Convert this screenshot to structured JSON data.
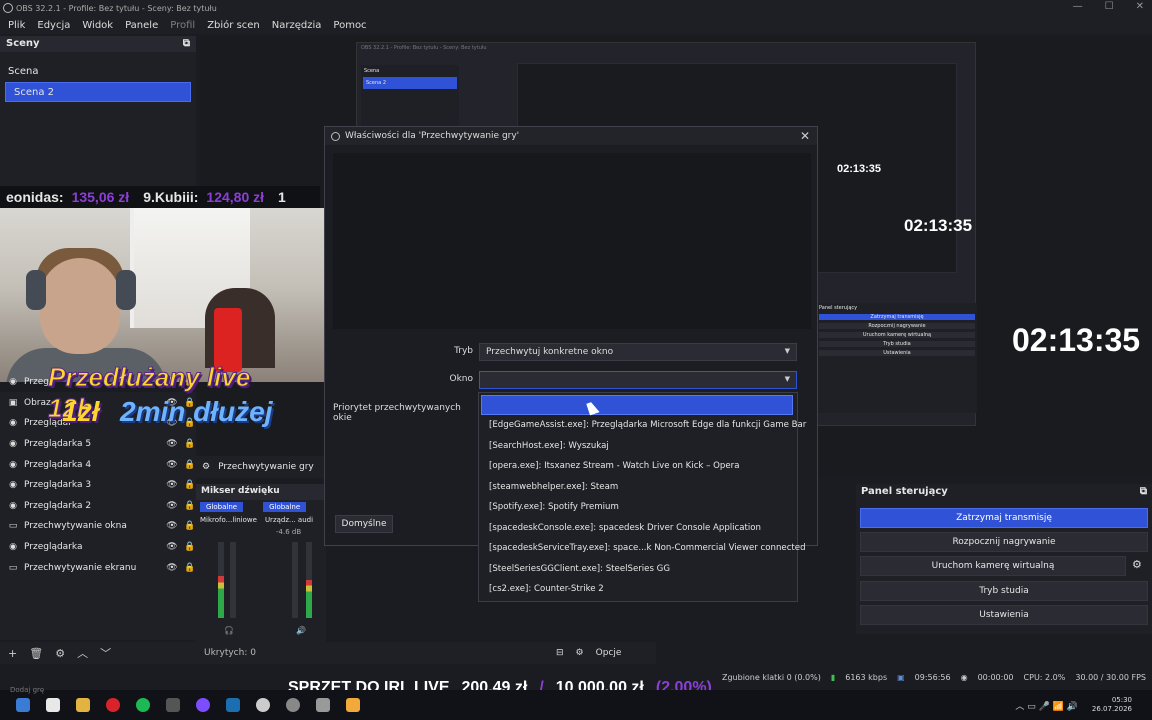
{
  "window": {
    "title": "OBS 32.2.1 - Profile: Bez tytułu - Sceny: Bez tytułu",
    "min": "—",
    "max": "☐",
    "close": "✕"
  },
  "menu": [
    "Plik",
    "Edycja",
    "Widok",
    "Panele",
    "Profil",
    "Zbiór scen",
    "Narzędzia",
    "Pomoc"
  ],
  "scenes": {
    "title": "Sceny",
    "items": [
      "Scena",
      "Scena 2"
    ],
    "selected": 1
  },
  "overlay": {
    "donor1_name": "eonidas:",
    "donor1_amount": "135,06 zł",
    "donor2_name": "9.Kubiii:",
    "donor2_amount": "124,80 zł",
    "donor3": "1",
    "promo_line1": "Przedłużany live 12h",
    "promo_line2": "1zł",
    "promo_line3": "2min dłużej",
    "clock_small": "02:13:35",
    "clock_mid": "02:13:35",
    "clock_big": "02:13:35"
  },
  "sources": {
    "items": [
      {
        "name": "Przeg",
        "icon": "◉"
      },
      {
        "name": "Obraz",
        "icon": "▣"
      },
      {
        "name": "Przeglądar",
        "icon": "◉"
      },
      {
        "name": "Przeglądarka 5",
        "icon": "◉"
      },
      {
        "name": "Przeglądarka 4",
        "icon": "◉"
      },
      {
        "name": "Przeglądarka 3",
        "icon": "◉"
      },
      {
        "name": "Przeglądarka 2",
        "icon": "◉"
      },
      {
        "name": "Przechwytywanie okna",
        "icon": "▭"
      },
      {
        "name": "Przeglądarka",
        "icon": "◉"
      },
      {
        "name": "Przechwytywanie ekranu",
        "icon": "▭"
      }
    ],
    "add": "+",
    "remove": "🗑",
    "settings": "⚙",
    "up": "︿",
    "down": "﹀"
  },
  "toolbar_mid": {
    "source_label": "Przechwytywanie gry",
    "hidden": "Ukrytych: 0",
    "options": "Opcje"
  },
  "mixer": {
    "title": "Mikser dźwięku",
    "tab_global": "Globalne",
    "tab_global2": "Globalne",
    "ch1": "Mikrofo...liniowe",
    "ch2": "Urządz... audi",
    "db": "-4.6 dB",
    "mic_level": 0.55,
    "desk_level": 0.5
  },
  "dialog": {
    "title": "Właściwości dla 'Przechwytywanie gry'",
    "close": "✕",
    "mode_label": "Tryb",
    "mode_value": "Przechwytuj konkretne okno",
    "window_label": "Okno",
    "window_value": "",
    "priority_label": "Priorytet przechwytywanych okie",
    "defaults": "Domyślne"
  },
  "dropdown": {
    "options": [
      "[EdgeGameAssist.exe]: Przeglądarka Microsoft Edge dla funkcji Game Bar",
      "[SearchHost.exe]: Wyszukaj",
      "[opera.exe]: Itsxanez Stream - Watch Live on Kick – Opera",
      "[steamwebhelper.exe]: Steam",
      "[Spotify.exe]: Spotify Premium",
      "[spacedeskConsole.exe]: spacedesk Driver Console Application",
      "[spacedeskServiceTray.exe]: space...k Non-Commercial Viewer connected",
      "[SteelSeriesGGClient.exe]: SteelSeries GG",
      "[cs2.exe]: Counter-Strike 2"
    ]
  },
  "controls": {
    "title": "Panel sterujący",
    "buttons": [
      "Zatrzymaj transmisję",
      "Rozpocznij nagrywanie",
      "Uruchom kamerę wirtualną",
      "Tryb studia",
      "Ustawienia"
    ],
    "active": 0
  },
  "status": {
    "dropped": "Zgubione klatki 0 (0.0%)",
    "kbps": "6163 kbps",
    "stream_time": "09:56:56",
    "rec_time": "00:00:00",
    "cpu": "CPU: 2.0%",
    "fps": "30.00 / 30.00 FPS"
  },
  "ticker": {
    "label": "SPRZET DO IRL LIVE",
    "raised": "200,49 zł",
    "sep": "/",
    "goal": "10 000,00 zł",
    "pct": "(2.00%)"
  },
  "taskbar": {
    "time": "05:30",
    "date": "26.07.2026",
    "add_game": "Dodaj grę"
  },
  "colors": {
    "accent": "#2f52d6",
    "bg": "#1b1c21",
    "purple": "#8b3fd6",
    "promo_yellow": "#ffd52e"
  }
}
